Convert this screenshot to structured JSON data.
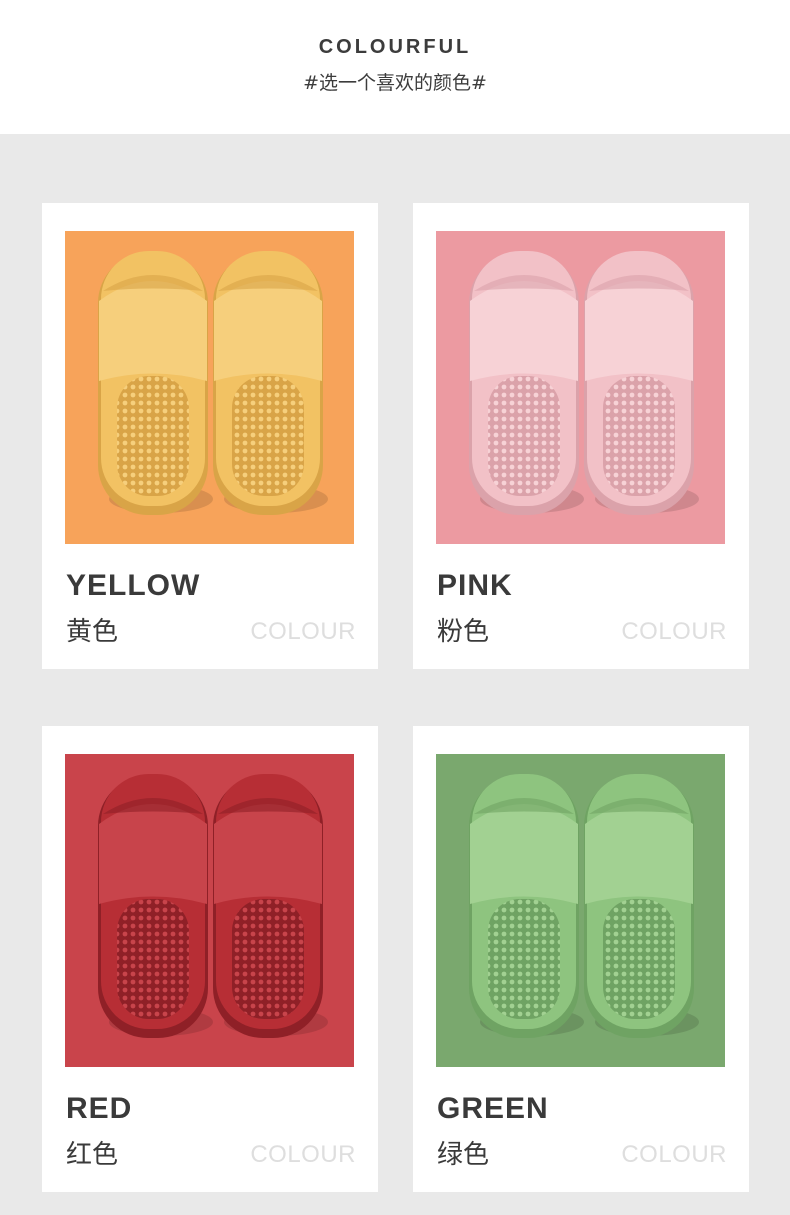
{
  "header": {
    "title": "COLOURFUL",
    "subtitle": "#选一个喜欢的颜色#"
  },
  "cards": [
    {
      "name_en": "YELLOW",
      "name_cn": "黄色",
      "tag": "COLOUR",
      "bg_color": "#f7a35a",
      "slipper_color": "#f2c263",
      "slipper_dark": "#d9a447",
      "slipper_light": "#f6cf7c"
    },
    {
      "name_en": "PINK",
      "name_cn": "粉色",
      "tag": "COLOUR",
      "bg_color": "#ec9aa1",
      "slipper_color": "#f2c1c7",
      "slipper_dark": "#dba2aa",
      "slipper_light": "#f7d2d6"
    },
    {
      "name_en": "RED",
      "name_cn": "红色",
      "tag": "COLOUR",
      "bg_color": "#c9444b",
      "slipper_color": "#b72e35",
      "slipper_dark": "#8f2027",
      "slipper_light": "#c8444b"
    },
    {
      "name_en": "GREEN",
      "name_cn": "绿色",
      "tag": "COLOUR",
      "bg_color": "#7aa86e",
      "slipper_color": "#8ec47f",
      "slipper_dark": "#6fa363",
      "slipper_light": "#a2d192"
    }
  ]
}
